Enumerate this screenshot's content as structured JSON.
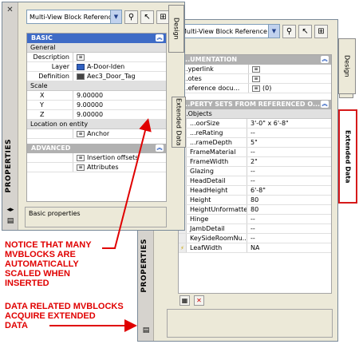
{
  "left_palette": {
    "title": "PROPERTIES",
    "combo_value": "Multi-View Block Reference",
    "tabs": {
      "design": "Design",
      "extended": "Extended Data"
    },
    "basic_header": "BASIC",
    "general": {
      "label": "General",
      "rows": [
        {
          "key": "Description",
          "value": ""
        },
        {
          "key": "Layer",
          "value": "A-Door-Iden"
        },
        {
          "key": "Definition",
          "value": "Aec3_Door_Tag"
        }
      ]
    },
    "scale": {
      "label": "Scale",
      "rows": [
        {
          "key": "X",
          "value": "9.00000"
        },
        {
          "key": "Y",
          "value": "9.00000"
        },
        {
          "key": "Z",
          "value": "9.00000"
        }
      ]
    },
    "location": {
      "label": "Location on entity",
      "anchor": "Anchor"
    },
    "advanced_header": "ADVANCED",
    "advanced_rows": [
      "Insertion offsets",
      "Attributes"
    ],
    "description_text": "Basic properties"
  },
  "right_palette": {
    "title": "PROPERTIES",
    "combo_value": "Multi-View Block Reference",
    "tabs": {
      "design": "Design",
      "extended": "Extended Data"
    },
    "documentation_header": "...UMENTATION",
    "doc_rows": [
      {
        "key": "...yperlink",
        "value": ""
      },
      {
        "key": "...otes",
        "value": ""
      },
      {
        "key": "...eference docu...",
        "value": "(0)"
      }
    ],
    "property_sets_header": "...PERTY SETS FROM REFERENCED O...",
    "objects_label": "...Objects",
    "rows": [
      {
        "key": "...oorSize",
        "value": "3'-0\" x 6'-8\"",
        "lightning": false
      },
      {
        "key": "...reRating",
        "value": "--",
        "lightning": false
      },
      {
        "key": "...rameDepth",
        "value": "5\"",
        "lightning": false
      },
      {
        "key": "FrameMaterial",
        "value": "--",
        "lightning": false
      },
      {
        "key": "FrameWidth",
        "value": "2\"",
        "lightning": false
      },
      {
        "key": "Glazing",
        "value": "--",
        "lightning": false
      },
      {
        "key": "HeadDetail",
        "value": "--",
        "lightning": false
      },
      {
        "key": "HeadHeight",
        "value": "6'-8\"",
        "lightning": false
      },
      {
        "key": "Height",
        "value": "80",
        "lightning": false
      },
      {
        "key": "HeightUnformatted",
        "value": "80",
        "lightning": true
      },
      {
        "key": "Hinge",
        "value": "--",
        "lightning": false
      },
      {
        "key": "JambDetail",
        "value": "--",
        "lightning": false
      },
      {
        "key": "KeySideRoomNu...",
        "value": "--",
        "lightning": false
      },
      {
        "key": "LeafWidth",
        "value": "NA",
        "lightning": true
      }
    ]
  },
  "callouts": {
    "first": [
      "NOTICE THAT MANY",
      "MVBLOCKS ARE",
      "AUTOMATICALLY",
      "SCALED WHEN",
      "INSERTED"
    ],
    "second": [
      "DATA RELATED MVBLOCKS",
      "ACQUIRE EXTENDED",
      "DATA"
    ]
  },
  "colors": {
    "annotation": "#e00000",
    "section_header": "#3e6bc6",
    "palette_bg": "#ece9d8"
  },
  "icons": [
    "close-icon",
    "autohide-icon",
    "properties-menu-icon",
    "quick-select-icon",
    "select-objects-icon",
    "toggle-pickadd-icon",
    "collapse-icon",
    "lightning-icon"
  ]
}
